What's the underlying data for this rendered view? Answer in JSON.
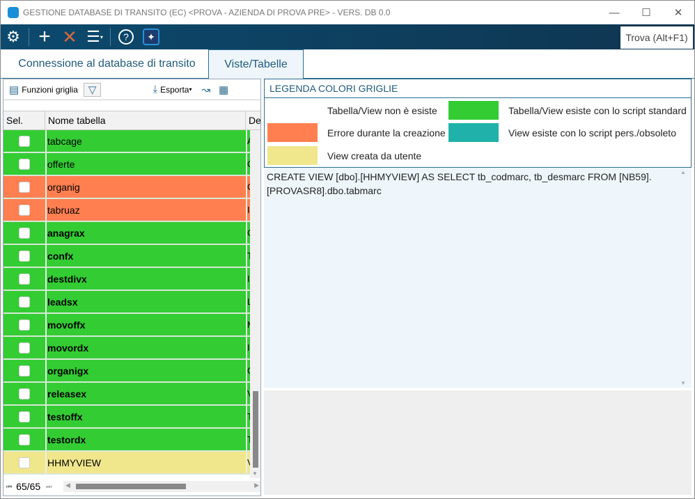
{
  "window": {
    "title": "GESTIONE DATABASE DI TRANSITO (EC) <PROVA - AZIENDA DI PROVA PRE> - VERS. DB 0.0"
  },
  "toolbar": {
    "find_label": "Trova (Alt+F1)"
  },
  "tabs": [
    {
      "label": "Connessione al database di transito"
    },
    {
      "label": "Viste/Tabelle",
      "active": true
    }
  ],
  "grid": {
    "functions_label": "Funzioni griglia",
    "export_label": "Esporta",
    "columns": [
      "Sel.",
      "Nome tabella",
      "De"
    ],
    "rows": [
      {
        "name": "tabcage",
        "desc": "A",
        "status": "standard",
        "bold": false
      },
      {
        "name": "offerte",
        "desc": "O",
        "status": "standard",
        "bold": false
      },
      {
        "name": "organig",
        "desc": "O",
        "status": "error",
        "bold": false
      },
      {
        "name": "tabruaz",
        "desc": "I",
        "status": "error",
        "bold": false
      },
      {
        "name": "anagrax",
        "desc": "C",
        "status": "standard",
        "bold": true
      },
      {
        "name": "confx",
        "desc": "T",
        "status": "standard",
        "bold": true
      },
      {
        "name": "destdivx",
        "desc": "I",
        "status": "standard",
        "bold": true
      },
      {
        "name": "leadsx",
        "desc": "L",
        "status": "standard",
        "bold": true
      },
      {
        "name": "movoffx",
        "desc": "M",
        "status": "standard",
        "bold": true
      },
      {
        "name": "movordx",
        "desc": "I",
        "status": "standard",
        "bold": true
      },
      {
        "name": "organigx",
        "desc": "O",
        "status": "standard",
        "bold": true
      },
      {
        "name": "releasex",
        "desc": "V",
        "status": "standard",
        "bold": true
      },
      {
        "name": "testoffx",
        "desc": "T",
        "status": "standard",
        "bold": true
      },
      {
        "name": "testordx",
        "desc": "T",
        "status": "standard",
        "bold": true
      },
      {
        "name": "HHMYVIEW",
        "desc": "V",
        "status": "user",
        "bold": false
      }
    ],
    "record_counter": "65/65"
  },
  "legend": {
    "title": "LEGENDA COLORI GRIGLIE",
    "items": [
      {
        "label": "Tabella/View non è esiste",
        "color": "#ffffff"
      },
      {
        "label": "Tabella/View esiste con lo script standard",
        "color": "#33cc33"
      },
      {
        "label": "Errore durante la creazione",
        "color": "#ff7f50"
      },
      {
        "label": "View esiste con lo script pers./obsoleto",
        "color": "#20b2aa"
      },
      {
        "label": "View creata da utente",
        "color": "#f0e68c"
      }
    ]
  },
  "sql_text": "CREATE VIEW [dbo].[HHMYVIEW] AS SELECT tb_codmarc, tb_desmarc FROM [NB59].[PROVASR8].dbo.tabmarc",
  "colors": {
    "standard": "#33cc33",
    "error": "#ff7f50",
    "user": "#f0e68c"
  }
}
